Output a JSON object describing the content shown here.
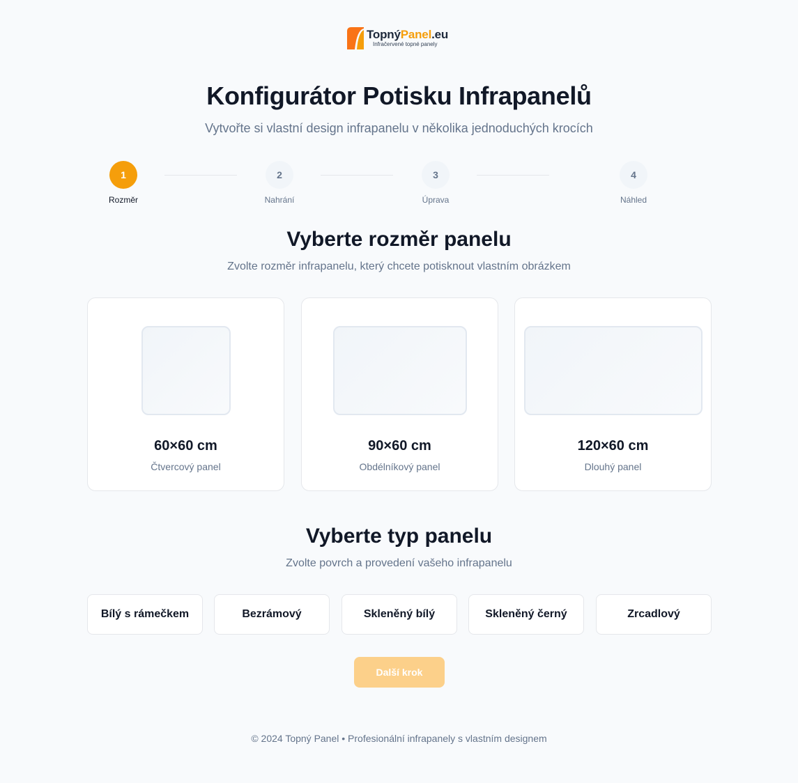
{
  "brand": {
    "name_main": "Topný",
    "name_accent": "Panel",
    "name_suffix": ".eu",
    "tagline": "Infračervené topné panely",
    "accent_color": "#f59e0b"
  },
  "header": {
    "title": "Konfigurátor Potisku Infrapanelů",
    "subtitle": "Vytvořte si vlastní design infrapanelu v několika jednoduchých krocích"
  },
  "stepper": {
    "current": 1,
    "steps": [
      {
        "number": "1",
        "label": "Rozměr"
      },
      {
        "number": "2",
        "label": "Nahrání"
      },
      {
        "number": "3",
        "label": "Úprava"
      },
      {
        "number": "4",
        "label": "Náhled"
      }
    ]
  },
  "size_section": {
    "title": "Vyberte rozměr panelu",
    "subtitle": "Zvolte rozměr infrapanelu, který chcete potisknout vlastním obrázkem",
    "options": [
      {
        "size": "60×60 cm",
        "description": "Čtvercový panel"
      },
      {
        "size": "90×60 cm",
        "description": "Obdélníkový panel"
      },
      {
        "size": "120×60 cm",
        "description": "Dlouhý panel"
      }
    ]
  },
  "type_section": {
    "title": "Vyberte typ panelu",
    "subtitle": "Zvolte povrch a provedení vašeho infrapanelu",
    "options": [
      {
        "label": "Bílý s rámečkem"
      },
      {
        "label": "Bezrámový"
      },
      {
        "label": "Skleněný bílý"
      },
      {
        "label": "Skleněný černý"
      },
      {
        "label": "Zrcadlový"
      }
    ]
  },
  "actions": {
    "next_label": "Další krok",
    "next_enabled": false
  },
  "footer": {
    "text": "© 2024 Topný Panel • Profesionální infrapanely s vlastním designem"
  }
}
